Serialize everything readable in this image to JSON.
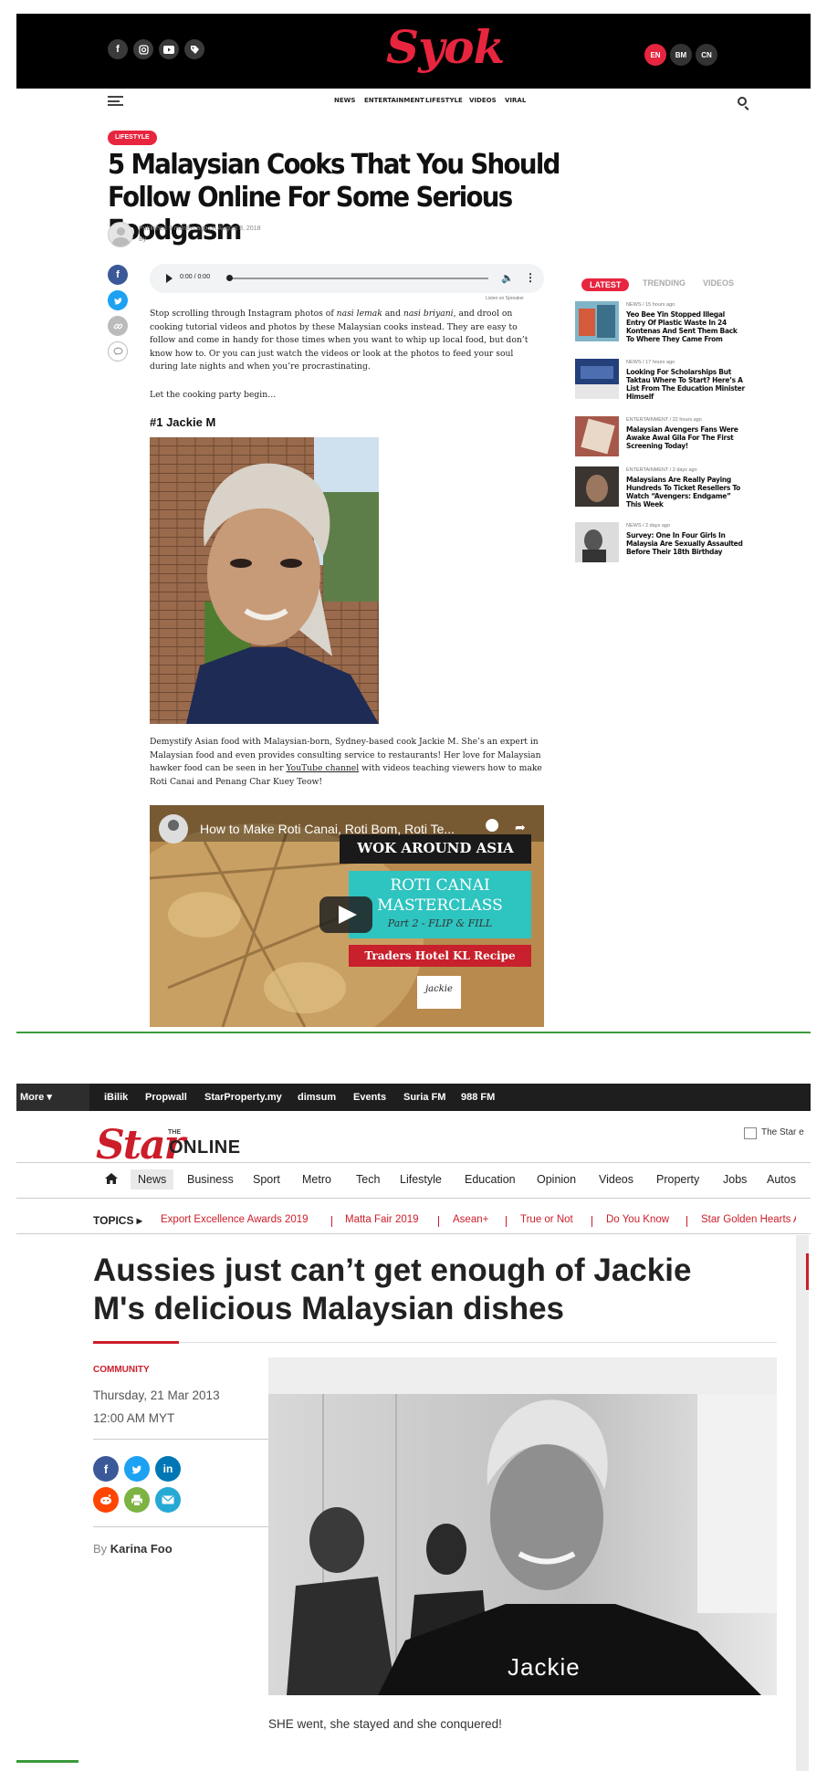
{
  "syok": {
    "logo": "Syok",
    "social_icons": [
      "facebook-icon",
      "instagram-icon",
      "youtube-icon",
      "tag-icon"
    ],
    "languages": [
      "EN",
      "BM",
      "CN"
    ],
    "nav": [
      "NEWS",
      "ENTERTAINMENT",
      "LIFESTYLE",
      "VIDEOS",
      "VIRAL"
    ],
    "tag": "LIFESTYLE",
    "title": "5 Malaysian Cooks That You Should Follow Online For Some Serious Foodgasm",
    "published": "Published 9 months ago on August 8, 2018",
    "by": "By",
    "share_icons": [
      "facebook-icon",
      "twitter-icon",
      "link-icon",
      "comment-icon"
    ],
    "audio": {
      "time": "0:00 / 0:00",
      "powered": "Listen on Spreaker"
    },
    "intro": "Stop scrolling through Instagram photos of nasi lemak and nasi briyani, and drool on cooking tutorial videos and photos by these Malaysian cooks instead. They are easy to follow and come in handy for those times when you want to whip up local food, but don’t know how to. Or you can just watch the videos or look at the photos to feed your soul during late nights and when you’re procrastinating.",
    "intro_parts": {
      "a": "Stop scrolling through Instagram photos of ",
      "b": "nasi lemak",
      "c": " and ",
      "d": "nasi briyani",
      "e": ", and drool on cooking tutorial videos and photos by these Malaysian cooks instead. They are easy to follow and come in handy for those times when you want to whip up local food, but don’t know how to. Or you can just watch the videos or look at the photos to feed your soul during late nights and when you’re procrastinating."
    },
    "let_party": "Let the cooking party begin…",
    "section1": "#1 Jackie M",
    "demystify": {
      "a": "Demystify Asian food with Malaysian-born, Sydney-based cook Jackie M. She’s an expert in Malaysian food and even provides consulting service to restaurants! Her love for Malaysian hawker food can be seen in her ",
      "link": "YouTube channel",
      "b": " with videos teaching viewers how to make Roti Canai and Penang Char Kuey Teow!"
    },
    "video": {
      "title": "How to Make Roti Canai, Roti Bom, Roti Te...",
      "banner1": "WOK AROUND ASIA",
      "banner2a": "ROTI CANAI",
      "banner2b": "MASTERCLASS",
      "banner2c": "Part 2 - FLIP & FILL",
      "banner3": "Traders Hotel KL Recipe",
      "logo": "jackie"
    },
    "sidebar": {
      "tabs": [
        "LATEST",
        "TRENDING",
        "VIDEOS"
      ],
      "items": [
        {
          "cat": "NEWS / 15 hours ago",
          "title": "Yeo Bee Yin Stopped Illegal Entry Of Plastic Waste In 24 Kontenas And Sent Them Back To Where They Came From"
        },
        {
          "cat": "NEWS / 17 hours ago",
          "title": "Looking For Scholarships But Taktau Where To Start? Here’s A List From The Education Minister Himself"
        },
        {
          "cat": "ENTERTAINMENT / 22 hours ago",
          "title": "Malaysian Avengers Fans Were Awake Awal Gila For The First Screening Today!"
        },
        {
          "cat": "ENTERTAINMENT / 2 days ago",
          "title": "Malaysians Are Really Paying Hundreds To Ticket Resellers To Watch “Avengers: Endgame” This Week"
        },
        {
          "cat": "NEWS / 2 days ago",
          "title": "Survey: One In Four Girls In Malaysia Are Sexually Assaulted Before Their 18th Birthday"
        }
      ]
    }
  },
  "star": {
    "more": "More ▾",
    "toplinks": [
      "iBilik",
      "Propwall",
      "StarProperty.my",
      "dimsum",
      "Events",
      "Suria FM",
      "988 FM"
    ],
    "logo_the": "THE",
    "logo_star": "Star",
    "logo_online": "ONLINE",
    "edge_text": "The Star e",
    "nav": [
      "News",
      "Business",
      "Sport",
      "Metro",
      "Tech",
      "Lifestyle",
      "Education",
      "Opinion",
      "Videos",
      "Property",
      "Jobs",
      "Autos"
    ],
    "topics_label": "TOPICS ▸",
    "topics": [
      "Export Excellence Awards 2019",
      "Matta Fair 2019",
      "Asean+",
      "True or Not",
      "Do You Know",
      "Star Golden Hearts Av"
    ],
    "title": "Aussies just can’t get enough of Jackie M's delicious Malaysian dishes",
    "category": "COMMUNITY",
    "date": "Thursday, 21 Mar 2013",
    "time": "12:00 AM MYT",
    "by": "By",
    "author": "Karina Foo",
    "apron_text": "Jackie",
    "lede": "SHE went, she stayed and she conquered!",
    "share_icons": [
      "facebook-icon",
      "twitter-icon",
      "linkedin-icon",
      "reddit-icon",
      "print-icon",
      "email-icon"
    ]
  },
  "colors": {
    "syok_red": "#e8253f",
    "star_red": "#cc1d2a"
  }
}
